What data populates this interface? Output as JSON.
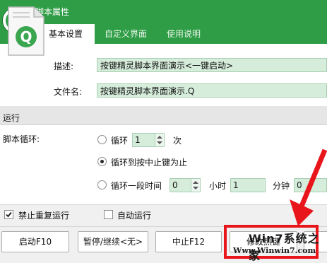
{
  "window": {
    "title": "脚本属性"
  },
  "tabs": [
    {
      "label": "基本设置",
      "active": true
    },
    {
      "label": "自定义界面",
      "active": false
    },
    {
      "label": "使用说明",
      "active": false
    }
  ],
  "info": {
    "file_icon_letter": "Q",
    "description_label": "描述:",
    "description_value": "按键精灵脚本界面演示<一键启动>",
    "filename_label": "文件名:",
    "filename_value": "按键精灵脚本界面演示.Q"
  },
  "run": {
    "section_title": "运行",
    "loop_label": "脚本循环:",
    "option_loop_label": "循环",
    "option_loop_count": "1",
    "option_loop_unit": "次",
    "option_until_stop_label": "循环到按中止键为止",
    "option_timed_label": "循环一段时间",
    "timed_hours_value": "0",
    "hours_unit": "小时",
    "timed_minutes_value": "1",
    "minutes_unit": "分钟",
    "timed_seconds_value": "0",
    "selected_option": "until_stop"
  },
  "options": {
    "no_repeat_label": "禁止重复运行",
    "no_repeat_checked": true,
    "auto_run_label": "自动运行",
    "auto_run_checked": false
  },
  "buttons": {
    "start": "启动F10",
    "pause": "暂停/继续<无>",
    "stop": "中止F12",
    "hotkey": "修改热键"
  },
  "watermark": {
    "brand": "Win7系统之家",
    "url": "Www.Winwin7.com"
  },
  "colors": {
    "header_green": "#2f9d46",
    "field_green": "#d6eddb",
    "highlight_red": "#e8151b"
  }
}
